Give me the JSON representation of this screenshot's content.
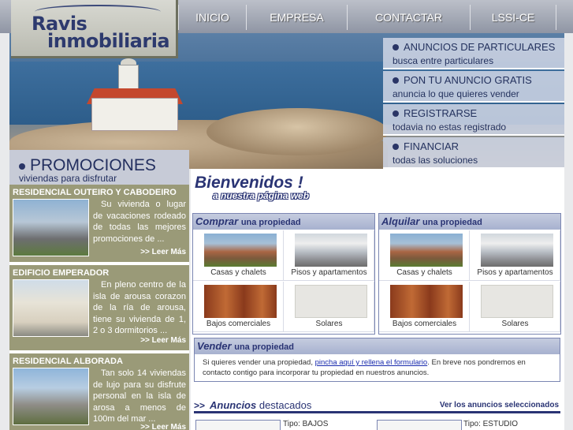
{
  "logo": {
    "line1": "Ravis",
    "line2": "inmobiliaria"
  },
  "nav": [
    "INICIO",
    "EMPRESA",
    "CONTACTAR",
    "LSSI-CE"
  ],
  "hero_menu": [
    {
      "title": "ANUNCIOS DE PARTICULARES",
      "sub": "busca entre particulares"
    },
    {
      "title": "PON TU ANUNCIO GRATIS",
      "sub": "anuncia lo que quieres vender"
    },
    {
      "title": "REGISTRARSE",
      "sub": "todavia no estas registrado"
    },
    {
      "title": "FINANCIAR",
      "sub": "todas las soluciones"
    }
  ],
  "promociones": {
    "title": "PROMOCIONES",
    "subtitle": "viviendas para disfrutar",
    "items": [
      {
        "name": "RESIDENCIAL OUTEIRO Y CABODEIRO",
        "text": "Su vivienda o lugar de vacaciones rodeado de todas las mejores promociones de ...",
        "more": ">> Leer Más"
      },
      {
        "name": "EDIFICIO EMPERADOR",
        "text": "En pleno centro de la isla de arousa corazon de la ría de arousa, tiene su vivienda de 1, 2 o 3 dormitorios ...",
        "more": ">> Leer Más"
      },
      {
        "name": "RESIDENCIAL ALBORADA",
        "text": "Tan solo 14 viviendas de lujo para su disfrute personal en la isla de arosa a menos de 100m del mar ...",
        "more": ">> Leer Más"
      }
    ]
  },
  "main": {
    "welcome": "Bienvenidos !",
    "welcome_sub": "a nuestra página web",
    "comprar": {
      "title": "Comprar",
      "rest": "una propiedad",
      "tiles": [
        "Casas y chalets",
        "Pisos y apartamentos",
        "Bajos comerciales",
        "Solares"
      ]
    },
    "alquilar": {
      "title": "Alquilar",
      "rest": "una propiedad",
      "tiles": [
        "Casas y chalets",
        "Pisos y apartamentos",
        "Bajos comerciales",
        "Solares"
      ]
    },
    "vender": {
      "title": "Vender",
      "rest": "una propiedad",
      "text_before": "Si quieres vender una propiedad, ",
      "link": "pincha aquí y rellena el formulario",
      "text_after": ". En breve nos pondremos en contacto contigo para incorporar tu propiedad en nuestros anuncios."
    },
    "destacados": {
      "arrow": ">>",
      "title_bold": "Anuncios",
      "title_rest": " destacados",
      "link": "Ver los anuncios seleccionados",
      "tipo1": "Tipo: BAJOS",
      "tipo2": "Tipo: ESTUDIO"
    }
  }
}
